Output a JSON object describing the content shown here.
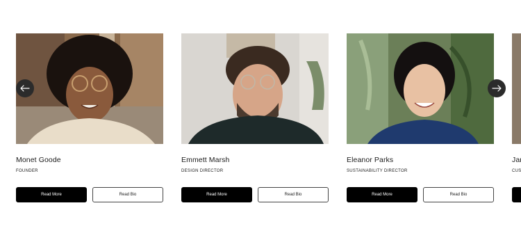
{
  "team": [
    {
      "name": "Monet Goode",
      "role": "FOUNDER",
      "read_more": "Read More",
      "read_bio": "Read Bio"
    },
    {
      "name": "Emmett Marsh",
      "role": "DESIGN DIRECTOR",
      "read_more": "Read More",
      "read_bio": "Read Bio"
    },
    {
      "name": "Eleanor Parks",
      "role": "SUSTAINABILITY DIRECTOR",
      "read_more": "Read More",
      "read_bio": "Read Bio"
    },
    {
      "name": "Jam",
      "role": "CUST",
      "read_more": "",
      "read_bio": ""
    }
  ],
  "nav": {
    "prev_icon": "arrow-left-icon",
    "next_icon": "arrow-right-icon"
  },
  "colors": {
    "primary_button": "#000000",
    "outline_border": "#444444",
    "arrow_bg": "#2b2b2b"
  }
}
